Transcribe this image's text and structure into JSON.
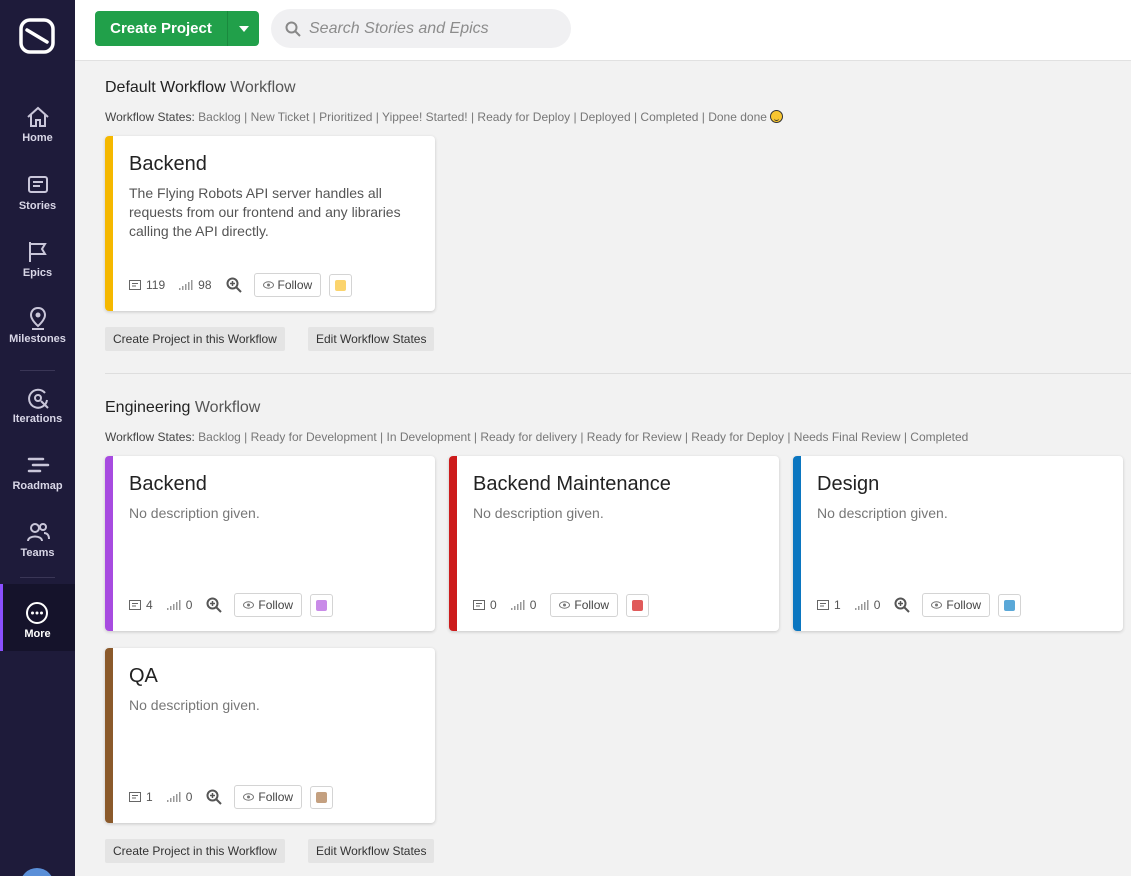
{
  "topbar": {
    "create_label": "Create Project",
    "search_placeholder": "Search Stories and Epics"
  },
  "sidebar": {
    "items": [
      {
        "label": "Home",
        "icon": "home-icon"
      },
      {
        "label": "Stories",
        "icon": "stories-icon"
      },
      {
        "label": "Epics",
        "icon": "epics-icon"
      },
      {
        "label": "Milestones",
        "icon": "milestones-icon"
      },
      {
        "label": "Iterations",
        "icon": "iterations-icon"
      },
      {
        "label": "Roadmap",
        "icon": "roadmap-icon"
      },
      {
        "label": "Teams",
        "icon": "teams-icon"
      },
      {
        "label": "More",
        "icon": "more-icon"
      }
    ]
  },
  "workflows": [
    {
      "name": "Default Workflow",
      "suffix": "Workflow",
      "states_label": "Workflow States:",
      "states": "Backlog | New Ticket | Prioritized | Yippee! Started! | Ready for Deploy | Deployed | Completed | Done done",
      "projects": [
        {
          "title": "Backend",
          "description": "The Flying Robots API server handles all requests from our frontend and any libraries calling the API directly.",
          "stories": "119",
          "points": "98",
          "follow": "Follow",
          "color": "#f5b800",
          "swatch": "#fbd46d"
        }
      ],
      "create_btn": "Create Project in this Workflow",
      "edit_btn": "Edit Workflow States"
    },
    {
      "name": "Engineering",
      "suffix": "Workflow",
      "states_label": "Workflow States:",
      "states": "Backlog | Ready for Development | In Development | Ready for delivery | Ready for Review | Ready for Deploy | Needs Final Review | Completed",
      "projects": [
        {
          "title": "Backend",
          "description": "No description given.",
          "stories": "4",
          "points": "0",
          "follow": "Follow",
          "color": "#a74be0",
          "swatch": "#c98be8"
        },
        {
          "title": "Backend Maintenance",
          "description": "No description given.",
          "stories": "0",
          "points": "0",
          "follow": "Follow",
          "color": "#cc1b1b",
          "swatch": "#e05a5a"
        },
        {
          "title": "Design",
          "description": "No description given.",
          "stories": "1",
          "points": "0",
          "follow": "Follow",
          "color": "#0b76c0",
          "swatch": "#5aa8d8"
        },
        {
          "title": "QA",
          "description": "No description given.",
          "stories": "1",
          "points": "0",
          "follow": "Follow",
          "color": "#8b5a2b",
          "swatch": "#c4a080"
        }
      ],
      "create_btn": "Create Project in this Workflow",
      "edit_btn": "Edit Workflow States"
    }
  ]
}
